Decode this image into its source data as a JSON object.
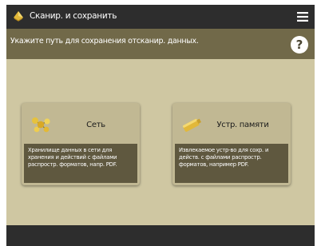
{
  "header": {
    "title": "Сканир. и сохранить",
    "icon": "scan-save-icon",
    "menu_icon": "hamburger-menu-icon"
  },
  "instruction": {
    "text": "Укажите путь для сохранения отсканир. данных.",
    "help_label": "?"
  },
  "destinations": [
    {
      "label": "Сеть",
      "icon": "network-icon",
      "description": "Хранилище данных в сети для хранения и действий с файлами распростр. форматов, напр. PDF."
    },
    {
      "label": "Устр. памяти",
      "icon": "memory-media-icon",
      "description": "Извлекаемое устр-во для сохр. и действ. с файлами распростр. форматов, например PDF."
    }
  ],
  "colors": {
    "title_bar": "#2d2d2d",
    "instruction_bar": "#716949",
    "background": "#cfc7a2",
    "card": "#c1b893",
    "card_description": "#5f583f"
  }
}
